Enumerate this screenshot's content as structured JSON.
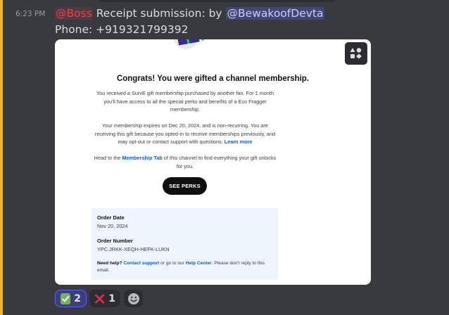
{
  "message": {
    "timestamp": "6:23 PM",
    "role_mention": "@Boss",
    "text_before_user": "Receipt submission: by",
    "user_mention": "@BewakoofDevta",
    "phone_line": "Phone: +919321799392"
  },
  "embed": {
    "title": "Congrats! You were gifted a channel membership.",
    "para1": "You received a SurvE gift membership purchased by another fan. For 1 month you'll have access to all the special perks and benefits of a Eco Fragger membership.",
    "para2_text": "Your membership expires on Dec 20, 2024, and is non-recurring. You are receiving this gift because you opted-in to receive memberships previously, and may opt-out or contact support with questions.",
    "para2_link": "Learn more",
    "para3_before": "Head to the",
    "para3_link": "Membership Tab",
    "para3_after": "of this channel to find everything your gift unlocks for you.",
    "button_label": "SEE PERKS",
    "order": {
      "date_label": "Order Date",
      "date_value": "Nov 20, 2024",
      "number_label": "Order Number",
      "number_value": "YPC.JRKK-XEQH-HEFK-LUKN",
      "help_bold": "Need help?",
      "help_link1": "Contact support",
      "help_mid": "or go to our",
      "help_link2": "Help Center",
      "help_end": ". Please don't reply to this email."
    }
  },
  "reactions": [
    {
      "emoji": "white-check-mark",
      "count": "2",
      "selected": true
    },
    {
      "emoji": "cross-mark",
      "count": "1",
      "selected": false
    },
    {
      "emoji": "add-reaction",
      "count": "",
      "selected": false
    }
  ],
  "colors": {
    "background": "#383a40",
    "highlight_bar": "#f0b232",
    "role_mention": "#f23f43",
    "user_mention_bg": "#5865f2",
    "link": "#065fd4"
  }
}
